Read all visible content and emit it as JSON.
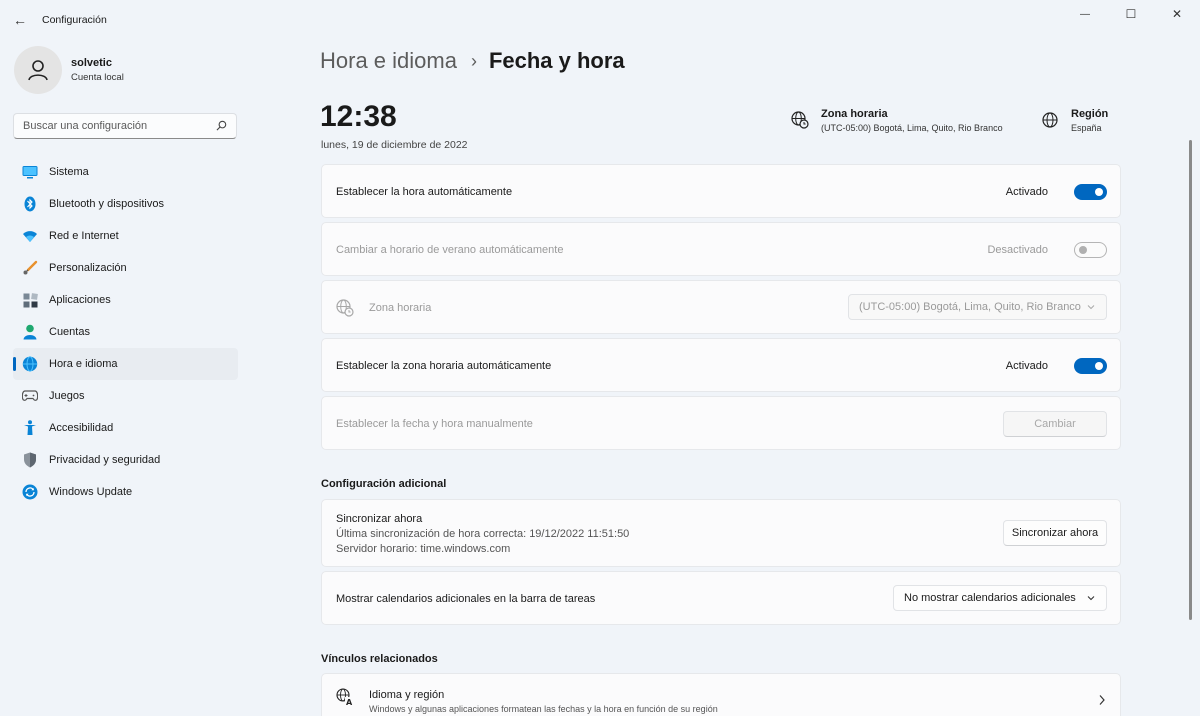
{
  "window": {
    "title": "Configuración",
    "back_glyph": "←",
    "controls": {
      "minimize": "—",
      "maximize": "☐",
      "close": "✕"
    }
  },
  "profile": {
    "name": "solvetic",
    "subtitle": "Cuenta local"
  },
  "search": {
    "placeholder": "Buscar una configuración"
  },
  "sidebar": {
    "items": [
      {
        "label": "Sistema",
        "icon": "system-icon"
      },
      {
        "label": "Bluetooth y dispositivos",
        "icon": "bluetooth-icon"
      },
      {
        "label": "Red e Internet",
        "icon": "wifi-icon"
      },
      {
        "label": "Personalización",
        "icon": "brush-icon"
      },
      {
        "label": "Aplicaciones",
        "icon": "apps-icon"
      },
      {
        "label": "Cuentas",
        "icon": "accounts-icon"
      },
      {
        "label": "Hora e idioma",
        "icon": "time-language-icon",
        "active": true
      },
      {
        "label": "Juegos",
        "icon": "gamepad-icon"
      },
      {
        "label": "Accesibilidad",
        "icon": "accessibility-icon"
      },
      {
        "label": "Privacidad y seguridad",
        "icon": "shield-icon"
      },
      {
        "label": "Windows Update",
        "icon": "update-icon"
      }
    ]
  },
  "breadcrumb": {
    "parent": "Hora e idioma",
    "separator": "›",
    "current": "Fecha y hora"
  },
  "clock": {
    "time": "12:38",
    "date": "lunes, 19 de diciembre de 2022"
  },
  "timezone_info": {
    "title": "Zona horaria",
    "value": "(UTC-05:00) Bogotá, Lima, Quito, Rio Branco"
  },
  "region_info": {
    "title": "Región",
    "value": "España"
  },
  "settings": {
    "auto_time": {
      "label": "Establecer la hora automáticamente",
      "state": "Activado"
    },
    "dst": {
      "label": "Cambiar a horario de verano automáticamente",
      "state": "Desactivado"
    },
    "timezone": {
      "label": "Zona horaria",
      "value": "(UTC-05:00) Bogotá, Lima, Quito, Rio Branco"
    },
    "auto_timezone": {
      "label": "Establecer la zona horaria automáticamente",
      "state": "Activado"
    },
    "manual": {
      "label": "Establecer la fecha y hora manualmente",
      "button": "Cambiar"
    }
  },
  "additional": {
    "title": "Configuración adicional",
    "sync": {
      "title": "Sincronizar ahora",
      "last_sync": "Última sincronización de hora correcta: 19/12/2022 11:51:50",
      "server": "Servidor horario: time.windows.com",
      "button": "Sincronizar ahora"
    },
    "calendars": {
      "label": "Mostrar calendarios adicionales en la barra de tareas",
      "value": "No mostrar calendarios adicionales"
    }
  },
  "related": {
    "title": "Vínculos relacionados",
    "language_region": {
      "title": "Idioma y región",
      "subtitle": "Windows y algunas aplicaciones formatean las fechas y la hora en función de su región"
    }
  },
  "colors": {
    "accent": "#0067c0",
    "background": "#f0f4f9",
    "card": "#fbfbfc"
  }
}
